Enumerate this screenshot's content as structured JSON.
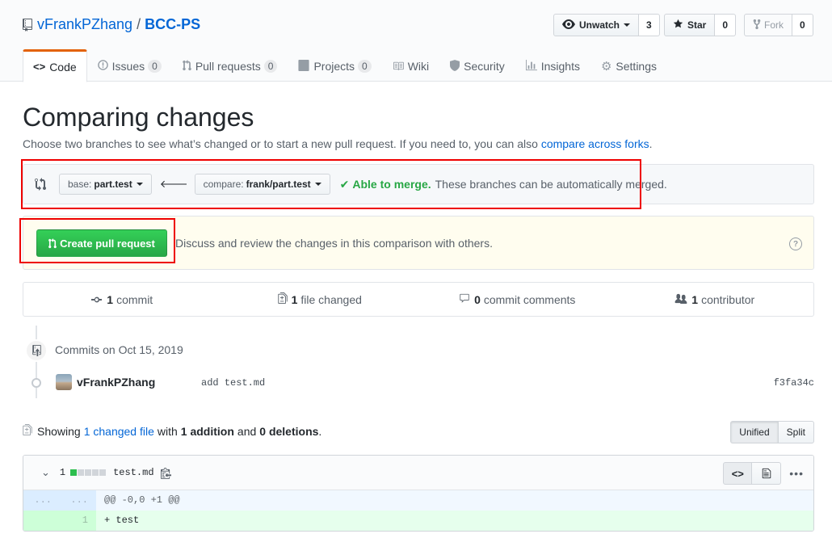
{
  "repo": {
    "owner": "vFrankPZhang",
    "separator": "/",
    "name": "BCC-PS"
  },
  "actions": {
    "watch_label": "Unwatch",
    "watch_count": "3",
    "star_label": "Star",
    "star_count": "0",
    "fork_label": "Fork",
    "fork_count": "0"
  },
  "nav": {
    "code": "Code",
    "issues": "Issues",
    "issues_count": "0",
    "pulls": "Pull requests",
    "pulls_count": "0",
    "projects": "Projects",
    "projects_count": "0",
    "wiki": "Wiki",
    "security": "Security",
    "insights": "Insights",
    "settings": "Settings"
  },
  "page": {
    "title": "Comparing changes",
    "desc": "Choose two branches to see what’s changed or to start a new pull request. If you need to, you can also",
    "desc_link": "compare across forks",
    "desc_end": "."
  },
  "range": {
    "base_prefix": "base:",
    "base_branch": "part.test",
    "compare_prefix": "compare:",
    "compare_branch": "frank/part.test",
    "merge_status": "Able to merge.",
    "merge_rest": "These branches can be automatically merged."
  },
  "pr": {
    "button": "Create pull request",
    "desc": "Discuss and review the changes in this comparison with others.",
    "help": "?"
  },
  "summary": {
    "commits_num": "1",
    "commits_label": "commit",
    "files_num": "1",
    "files_label": "file changed",
    "comments_num": "0",
    "comments_label": "commit comments",
    "contrib_num": "1",
    "contrib_label": "contributor"
  },
  "commits": {
    "group_title": "Commits on Oct 15, 2019",
    "author": "vFrankPZhang",
    "message": "add test.md",
    "sha": "f3fa34c"
  },
  "toc": {
    "showing": "Showing",
    "changed_link": "1 changed file",
    "with": "with",
    "additions": "1 addition",
    "and": "and",
    "deletions": "0 deletions",
    "end": ".",
    "unified": "Unified",
    "split": "Split"
  },
  "file": {
    "diffstat_num": "1",
    "diffstat_blocks": [
      "add",
      "neutral",
      "neutral",
      "neutral",
      "neutral"
    ],
    "name": "test.md",
    "hunk_left": "...",
    "hunk_right": "...",
    "hunk_header": "@@ -0,0 +1 @@",
    "added_line_num": "1",
    "added_line": "+ test"
  },
  "colors": {
    "accent": "#0366d6",
    "success": "#28a745",
    "highlight": "#e00000",
    "tab_underline": "#e36209"
  }
}
